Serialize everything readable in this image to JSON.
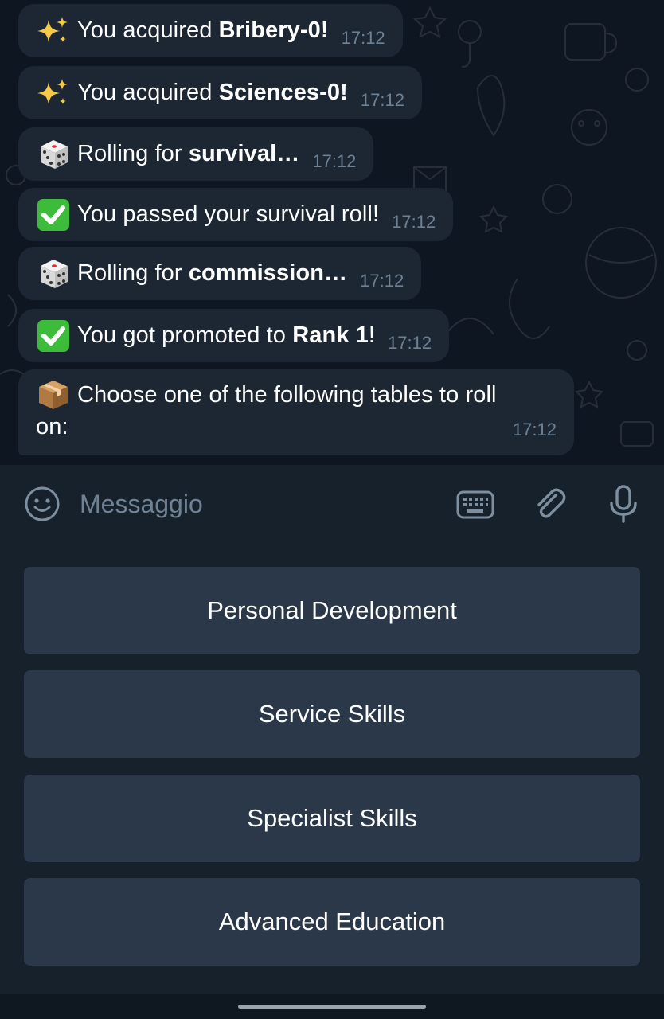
{
  "messages": [
    {
      "emoji": "sparkles",
      "pre": "You acquired ",
      "bold": "Bribery-0!",
      "post": "",
      "time": "17:12"
    },
    {
      "emoji": "sparkles",
      "pre": "You acquired ",
      "bold": "Sciences-0!",
      "post": "",
      "time": "17:12"
    },
    {
      "emoji": "dice",
      "pre": "Rolling for ",
      "bold": "survival…",
      "post": "",
      "time": "17:12"
    },
    {
      "emoji": "check",
      "pre": "You passed your survival roll!",
      "bold": "",
      "post": "",
      "time": "17:12"
    },
    {
      "emoji": "dice",
      "pre": "Rolling for ",
      "bold": "commission…",
      "post": "",
      "time": "17:12"
    },
    {
      "emoji": "check",
      "pre": "You got promoted to ",
      "bold": "Rank 1",
      "post": "!",
      "time": "17:12"
    }
  ],
  "last_message": {
    "emoji": "package",
    "line1": "Choose one of the following tables to roll",
    "line2": "on:",
    "time": "17:12"
  },
  "composer": {
    "placeholder": "Messaggio",
    "icons": [
      "emoji-icon",
      "keyboard-icon",
      "attach-icon",
      "microphone-icon"
    ]
  },
  "reply_keyboard": {
    "buttons": [
      "Personal Development",
      "Service Skills",
      "Specialist Skills",
      "Advanced Education"
    ]
  },
  "colors": {
    "background": "#0e1621",
    "bubble": "#1d2733",
    "panel": "#17212b",
    "button": "#2b3849",
    "timestamp": "#6d8196"
  }
}
